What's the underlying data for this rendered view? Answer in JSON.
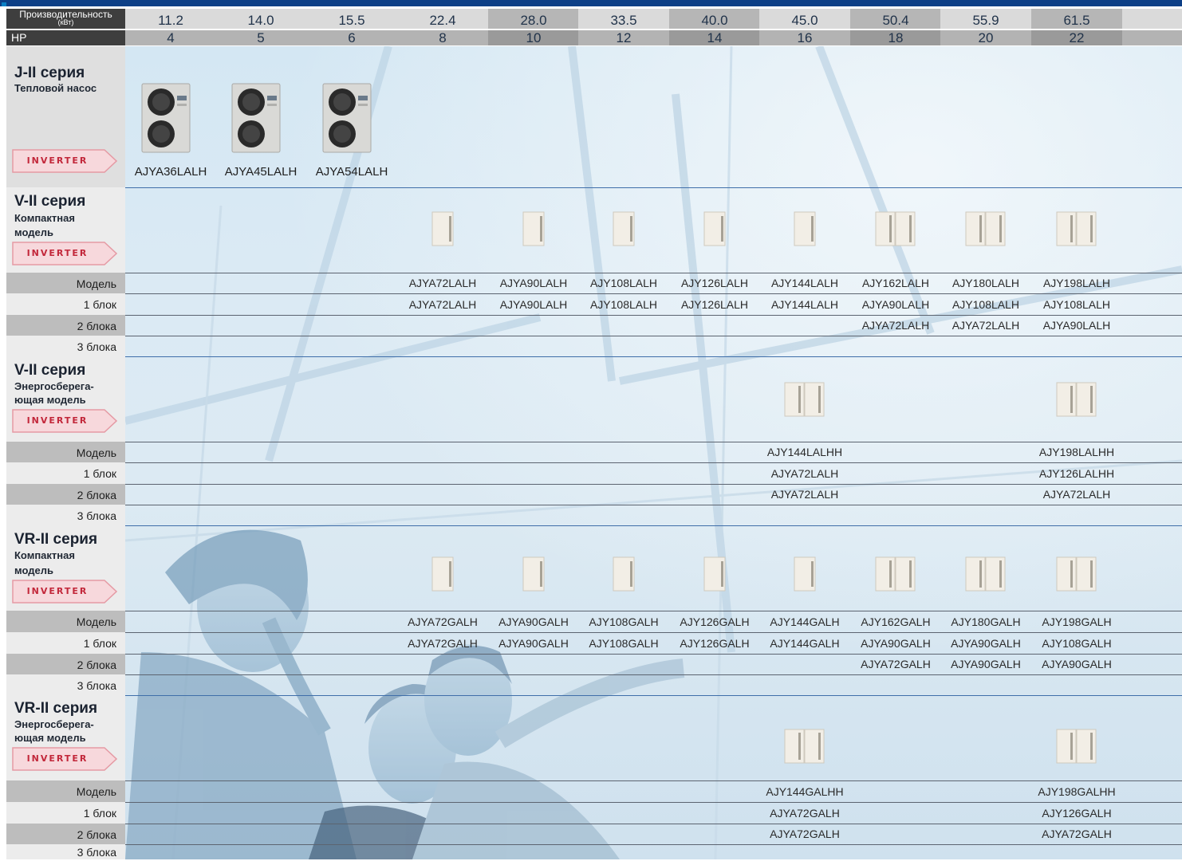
{
  "header": {
    "capacity_label": "Производительность",
    "capacity_unit": "(кВт)",
    "hp_label": "HP",
    "capacities": [
      "11.2",
      "14.0",
      "15.5",
      "22.4",
      "28.0",
      "33.5",
      "40.0",
      "45.0",
      "50.4",
      "55.9",
      "61.5"
    ],
    "hp": [
      "4",
      "5",
      "6",
      "8",
      "10",
      "12",
      "14",
      "16",
      "18",
      "20",
      "22"
    ]
  },
  "inverter_badge": "INVERTER",
  "row_labels": {
    "model": "Модель",
    "unit1": "1 блок",
    "unit2": "2 блока",
    "unit3": "3 блока"
  },
  "series": [
    {
      "name": "J-II серия",
      "sub1": "Тепловой насос",
      "sub2": "",
      "models": [
        "AJYA36LALH",
        "AJYA45LALH",
        "AJYA54LALH"
      ]
    },
    {
      "name": "V-II серия",
      "sub1": "Компактная",
      "sub2": "модель",
      "model": [
        "",
        "",
        "",
        "AJYA72LALH",
        "AJYA90LALH",
        "AJY108LALH",
        "AJY126LALH",
        "AJY144LALH",
        "AJY162LALH",
        "AJY180LALH",
        "AJY198LALH"
      ],
      "unit1": [
        "",
        "",
        "",
        "AJYA72LALH",
        "AJYA90LALH",
        "AJY108LALH",
        "AJY126LALH",
        "AJY144LALH",
        "AJYA90LALH",
        "AJY108LALH",
        "AJY108LALH"
      ],
      "unit2": [
        "",
        "",
        "",
        "",
        "",
        "",
        "",
        "",
        "AJYA72LALH",
        "AJYA72LALH",
        "AJYA90LALH"
      ],
      "unit3": [
        "",
        "",
        "",
        "",
        "",
        "",
        "",
        "",
        "",
        "",
        ""
      ]
    },
    {
      "name": "V-II серия",
      "sub1": "Энергосберега-",
      "sub2": "ющая модель",
      "model": [
        "",
        "",
        "",
        "",
        "",
        "",
        "",
        "AJY144LALHH",
        "",
        "",
        "AJY198LALHH"
      ],
      "unit1": [
        "",
        "",
        "",
        "",
        "",
        "",
        "",
        "AJYA72LALH",
        "",
        "",
        "AJY126LALHH"
      ],
      "unit2": [
        "",
        "",
        "",
        "",
        "",
        "",
        "",
        "AJYA72LALH",
        "",
        "",
        "AJYA72LALH"
      ],
      "unit3": [
        "",
        "",
        "",
        "",
        "",
        "",
        "",
        "",
        "",
        "",
        ""
      ]
    },
    {
      "name": "VR-II серия",
      "sub1": "Компактная",
      "sub2": "модель",
      "model": [
        "",
        "",
        "",
        "AJYA72GALH",
        "AJYA90GALH",
        "AJY108GALH",
        "AJY126GALH",
        "AJY144GALH",
        "AJY162GALH",
        "AJY180GALH",
        "AJY198GALH"
      ],
      "unit1": [
        "",
        "",
        "",
        "AJYA72GALH",
        "AJYA90GALH",
        "AJY108GALH",
        "AJY126GALH",
        "AJY144GALH",
        "AJYA90GALH",
        "AJYA90GALH",
        "AJY108GALH"
      ],
      "unit2": [
        "",
        "",
        "",
        "",
        "",
        "",
        "",
        "",
        "AJYA72GALH",
        "AJYA90GALH",
        "AJYA90GALH"
      ],
      "unit3": [
        "",
        "",
        "",
        "",
        "",
        "",
        "",
        "",
        "",
        "",
        ""
      ]
    },
    {
      "name": "VR-II серия",
      "sub1": "Энергосберега-",
      "sub2": "ющая модель",
      "model": [
        "",
        "",
        "",
        "",
        "",
        "",
        "",
        "AJY144GALHH",
        "",
        "",
        "AJY198GALHH"
      ],
      "unit1": [
        "",
        "",
        "",
        "",
        "",
        "",
        "",
        "AJYA72GALH",
        "",
        "",
        "AJY126GALH"
      ],
      "unit2": [
        "",
        "",
        "",
        "",
        "",
        "",
        "",
        "AJYA72GALH",
        "",
        "",
        "AJYA72GALH"
      ],
      "unit3": [
        "",
        "",
        "",
        "",
        "",
        "",
        "",
        "",
        "",
        "",
        ""
      ]
    }
  ],
  "colors": {
    "top_bar": "#0d3f86",
    "header_light": "#dedede",
    "header_dark": "#3e3e3e",
    "inverter_text": "#c2273a",
    "section_rule": "#3f6ea9"
  }
}
